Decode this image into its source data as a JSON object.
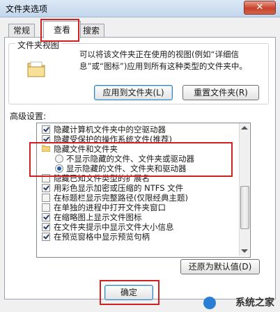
{
  "window": {
    "title": "文件夹选项",
    "close_glyph": "✕"
  },
  "tabs": [
    {
      "label": "常规",
      "active": false
    },
    {
      "label": "查看",
      "active": true
    },
    {
      "label": "搜索",
      "active": false
    }
  ],
  "folder_views": {
    "group_title": "文件夹视图",
    "description": "可以将该文件夹正在使用的视图(例如“详细信息”或“图标”)应用到所有这种类型的文件夹中。",
    "apply_button": "应用到文件夹(L)",
    "reset_button": "重置文件夹(R)"
  },
  "advanced": {
    "title": "高级设置:",
    "items": [
      {
        "type": "checkbox",
        "checked": true,
        "label": "隐藏计算机文件夹中的空驱动器"
      },
      {
        "type": "checkbox",
        "checked": true,
        "label": "隐藏受保护的操作系统文件(推荐)"
      },
      {
        "type": "folder",
        "label": "隐藏文件和文件夹"
      },
      {
        "type": "radio",
        "checked": false,
        "label": "不显示隐藏的文件、文件夹或驱动器"
      },
      {
        "type": "radio",
        "checked": true,
        "label": "显示隐藏的文件、文件夹和驱动器"
      },
      {
        "type": "checkbox",
        "checked": false,
        "label": "隐藏已知文件类型的扩展名"
      },
      {
        "type": "checkbox",
        "checked": true,
        "label": "用彩色显示加密或压缩的 NTFS 文件"
      },
      {
        "type": "checkbox",
        "checked": false,
        "label": "在标题栏显示完整路径(仅限经典主题)"
      },
      {
        "type": "checkbox",
        "checked": false,
        "label": "在单独的进程中打开文件夹窗口"
      },
      {
        "type": "checkbox",
        "checked": true,
        "label": "在缩略图上显示文件图标"
      },
      {
        "type": "checkbox",
        "checked": true,
        "label": "在文件夹提示中显示文件大小信息"
      },
      {
        "type": "checkbox",
        "checked": true,
        "label": "在预览窗格中显示预览句柄"
      }
    ],
    "restore_button": "还原为默认值(D)"
  },
  "footer": {
    "ok_button": "确定"
  },
  "watermark": {
    "text": "系统之家"
  },
  "colors": {
    "highlight_box": "#d02020",
    "title_bar": "#c4d6ec"
  }
}
